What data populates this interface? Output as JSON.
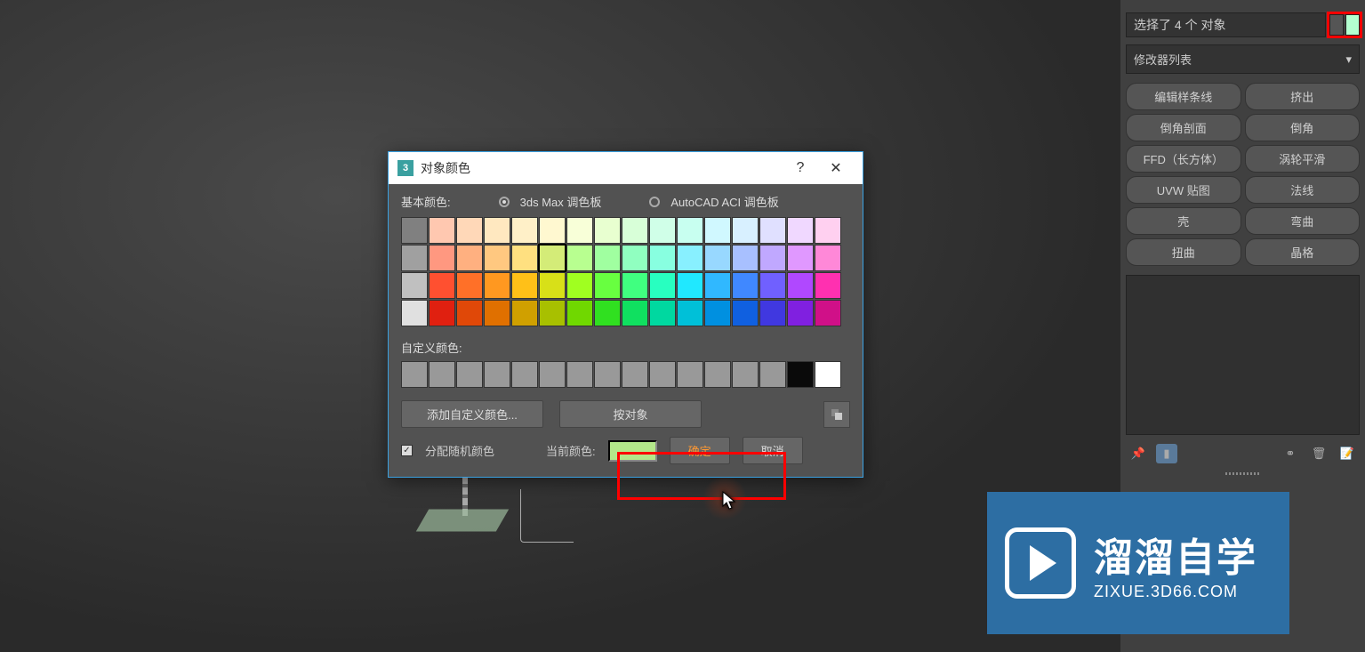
{
  "viewport": {},
  "sidePanel": {
    "selection_text": "选择了 4 个 对象",
    "modifier_list_label": "修改器列表",
    "modifier_buttons": [
      "编辑样条线",
      "挤出",
      "倒角剖面",
      "倒角",
      "FFD（长方体）",
      "涡轮平滑",
      "UVW 贴图",
      "法线",
      "壳",
      "弯曲",
      "扭曲",
      "晶格"
    ],
    "swatch_colors": [
      "#555555",
      "#b3ffd0"
    ]
  },
  "dialog": {
    "title": "对象颜色",
    "app_icon": "3",
    "basic_colors_label": "基本颜色:",
    "palette1_label": "3ds Max 调色板",
    "palette2_label": "AutoCAD ACI 调色板",
    "palette_selected": "3ds Max",
    "custom_colors_label": "自定义颜色:",
    "add_custom_label": "添加自定义颜色...",
    "by_object_label": "按对象",
    "assign_random_label": "分配随机颜色",
    "assign_random_checked": true,
    "current_color_label": "当前颜色:",
    "current_color": "#b4e88a",
    "ok_label": "确定",
    "cancel_label": "取消",
    "selected_color_index": 21,
    "color_grid": [
      "#808080",
      "#ffc8b0",
      "#ffd8b8",
      "#ffe8c0",
      "#fff0c8",
      "#fff8d0",
      "#f8ffd8",
      "#e8ffd0",
      "#d8ffd8",
      "#d0ffe8",
      "#c8fff0",
      "#d0f8ff",
      "#d8f0ff",
      "#e0e0ff",
      "#f0d8ff",
      "#ffd0f0",
      "#a0a0a0",
      "#ff9880",
      "#ffb080",
      "#ffc880",
      "#ffe080",
      "#d4ec78",
      "#b8ff90",
      "#a0ffa0",
      "#90ffc0",
      "#88ffe0",
      "#88f0ff",
      "#98d8ff",
      "#a8c0ff",
      "#c0a8ff",
      "#e098ff",
      "#ff88d8",
      "#c0c0c0",
      "#ff5030",
      "#ff7028",
      "#ff9820",
      "#ffc018",
      "#d8e018",
      "#a0ff20",
      "#68ff40",
      "#40ff80",
      "#28ffc0",
      "#20e8ff",
      "#30b8ff",
      "#4088ff",
      "#7060ff",
      "#b048ff",
      "#ff30b0",
      "#e0e0e0",
      "#e02010",
      "#e04808",
      "#e07000",
      "#d0a000",
      "#a8c000",
      "#70d800",
      "#30e020",
      "#10e060",
      "#00d8a0",
      "#00c0d8",
      "#0090e0",
      "#1060e0",
      "#4038e0",
      "#8020e0",
      "#d01088"
    ],
    "custom_colors": [
      "#999999",
      "#999999",
      "#999999",
      "#999999",
      "#999999",
      "#999999",
      "#999999",
      "#999999",
      "#999999",
      "#999999",
      "#999999",
      "#999999",
      "#999999",
      "#999999",
      "#0a0a0a",
      "#ffffff"
    ]
  },
  "watermark": {
    "line1": "溜溜自学",
    "line2": "ZIXUE.3D66.COM"
  }
}
